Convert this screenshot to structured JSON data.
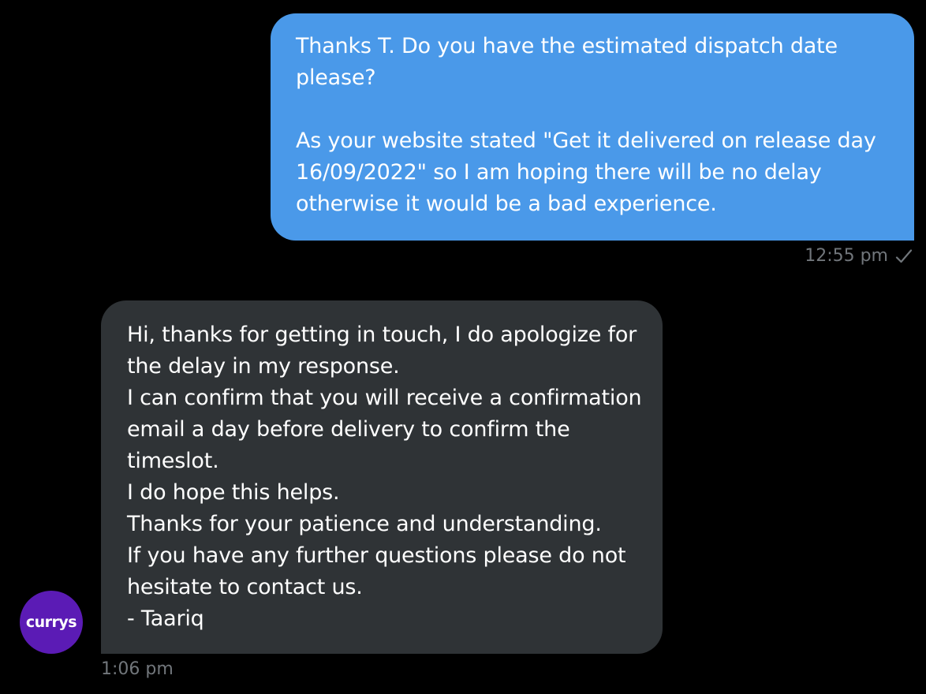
{
  "conversation": {
    "messages": [
      {
        "sender": "me",
        "text": "Thanks T. Do you have the estimated dispatch date please?\n\nAs your website stated \"Get it delivered on release day 16/09/2022\" so I am hoping there will be no delay otherwise it would be a bad experience.",
        "time": "12:55 pm",
        "status_icon": "check-icon",
        "bubble_color": "#4a99e9"
      },
      {
        "sender": "currys",
        "avatar_text": "currys",
        "avatar_color": "#5b1bb5",
        "text": "Hi, thanks for getting in touch, I do apologize for the delay in my response.\nI can confirm that you will receive a confirmation email a day before delivery to confirm the timeslot.\nI do hope this helps.\nThanks for your patience and understanding.\nIf you have any further questions please do not hesitate to contact us.\n- Taariq",
        "time": "1:06 pm",
        "bubble_color": "#2f3336"
      }
    ]
  }
}
